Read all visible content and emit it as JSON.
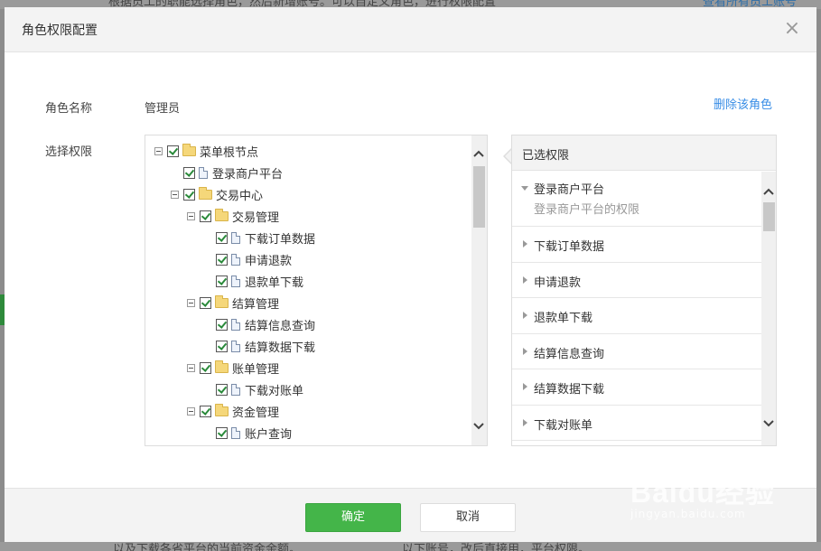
{
  "background": {
    "top_text": "根据员工的职能选择角色，然后新增账号。可以自定义角色，进行权限配置",
    "top_link": "查看所有员工账号",
    "bottom_left": "以及下载各省平台的当前资金余额。",
    "bottom_right": "以下账号，改后直接用，平台权限。"
  },
  "modal": {
    "title": "角色权限配置",
    "close_glyph": "×",
    "role_label": "角色名称",
    "role_value": "管理员",
    "delete_link": "删除该角色",
    "perm_label": "选择权限"
  },
  "tree": [
    {
      "level": 0,
      "type": "folder",
      "label": "菜单根节点",
      "expandable": true
    },
    {
      "level": 1,
      "type": "file",
      "label": "登录商户平台",
      "expandable": false
    },
    {
      "level": 1,
      "type": "folder",
      "label": "交易中心",
      "expandable": true
    },
    {
      "level": 2,
      "type": "folder",
      "label": "交易管理",
      "expandable": true
    },
    {
      "level": 3,
      "type": "file",
      "label": "下载订单数据",
      "expandable": false
    },
    {
      "level": 3,
      "type": "file",
      "label": "申请退款",
      "expandable": false
    },
    {
      "level": 3,
      "type": "file",
      "label": "退款单下载",
      "expandable": false
    },
    {
      "level": 2,
      "type": "folder",
      "label": "结算管理",
      "expandable": true
    },
    {
      "level": 3,
      "type": "file",
      "label": "结算信息查询",
      "expandable": false
    },
    {
      "level": 3,
      "type": "file",
      "label": "结算数据下载",
      "expandable": false
    },
    {
      "level": 2,
      "type": "folder",
      "label": "账单管理",
      "expandable": true
    },
    {
      "level": 3,
      "type": "file",
      "label": "下载对账单",
      "expandable": false
    },
    {
      "level": 2,
      "type": "folder",
      "label": "资金管理",
      "expandable": true
    },
    {
      "level": 3,
      "type": "file",
      "label": "账户查询",
      "expandable": false
    }
  ],
  "selected": {
    "title": "已选权限",
    "items": [
      {
        "label": "登录商户平台",
        "desc": "登录商户平台的权限",
        "expanded": true
      },
      {
        "label": "下载订单数据",
        "expanded": false
      },
      {
        "label": "申请退款",
        "expanded": false
      },
      {
        "label": "退款单下载",
        "expanded": false
      },
      {
        "label": "结算信息查询",
        "expanded": false
      },
      {
        "label": "结算数据下载",
        "expanded": false
      },
      {
        "label": "下载对账单",
        "expanded": false
      }
    ]
  },
  "footer": {
    "ok_label": "确定",
    "cancel_label": "取消"
  },
  "watermark": {
    "main": "Baidu经验",
    "sub": "jingyan.baidu.com"
  },
  "colors": {
    "accent_green": "#44b549",
    "link_blue": "#3a8ee6",
    "check_green": "#2a8a3a"
  },
  "icons": [
    "close-icon",
    "folder-icon",
    "file-icon",
    "checkbox-icon",
    "collapse-icon",
    "chevron-up-icon",
    "chevron-down-icon",
    "caret-right-icon",
    "caret-down-icon"
  ]
}
